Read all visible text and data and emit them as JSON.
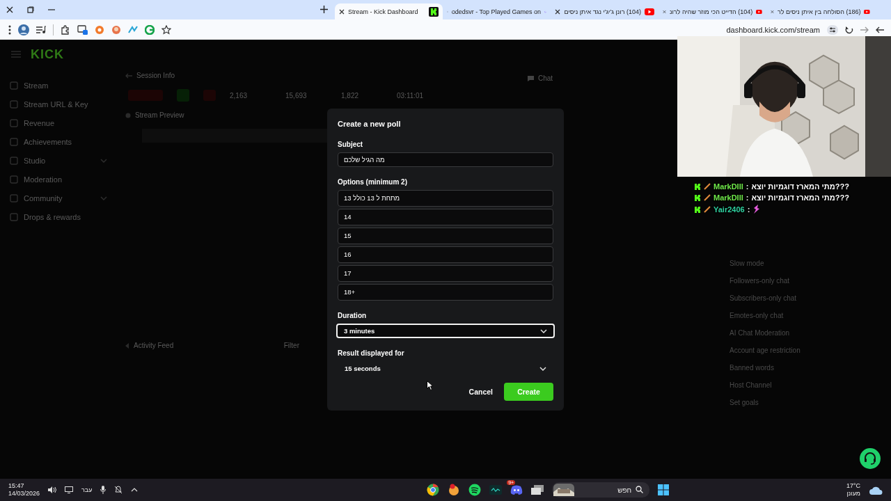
{
  "browser": {
    "tabs": [
      {
        "title": "(186) הסולחה בין איתן ניסים לר",
        "selected": false,
        "kind": "youtube"
      },
      {
        "title": "(104) הדייט הכי מוזר שהיה לרונ",
        "selected": false,
        "kind": "youtube"
      },
      {
        "title": "(104) רונן ג'יג'י נגד איתן ניסים",
        "selected": false,
        "kind": "youtube"
      },
      {
        "title": "odedsvr - Top Played Games on",
        "selected": false,
        "kind": "loading"
      },
      {
        "title": "Stream - Kick Dashboard",
        "selected": true,
        "kind": "kick"
      }
    ],
    "url": "dashboard.kick.com/stream"
  },
  "dashboard": {
    "logo": "KICK",
    "sidebar": [
      {
        "label": "Stream",
        "expandable": false
      },
      {
        "label": "Stream URL & Key",
        "expandable": false
      },
      {
        "label": "Revenue",
        "expandable": false
      },
      {
        "label": "Achievements",
        "expandable": false
      },
      {
        "label": "Studio",
        "expandable": true
      },
      {
        "label": "Moderation",
        "expandable": false
      },
      {
        "label": "Community",
        "expandable": true
      },
      {
        "label": "Drops & rewards",
        "expandable": false
      }
    ],
    "session_title": "Session Info",
    "stats": [
      "2,163",
      "15,693",
      "1,822",
      "03:11:01"
    ],
    "preview_title": "Stream Preview",
    "activity_title": "Activity Feed",
    "filter": "Filter",
    "chat_title": "Chat",
    "chat_settings": [
      "Slow mode",
      "Followers-only chat",
      "Subscribers-only chat",
      "Emotes-only chat",
      "AI Chat Moderation",
      "Account age restriction",
      "Banned words",
      "Host Channel",
      "Set goals"
    ]
  },
  "modal": {
    "title": "Create a new poll",
    "subject": {
      "label": "Subject",
      "value": "מה הגיל שלכם"
    },
    "options": {
      "label": "Options (minimum 2)",
      "values": [
        "מתחת ל 13 כולל 13",
        "14",
        "15",
        "16",
        "17",
        "18+"
      ]
    },
    "duration": {
      "label": "Duration",
      "value": "3 minutes",
      "focused": true
    },
    "result": {
      "label": "Result displayed for",
      "value": "15 seconds",
      "focused": false
    },
    "cancel": "Cancel",
    "create": "Create"
  },
  "chat_overlay": [
    {
      "username": "MarkDIII",
      "color": "#6fe84a",
      "separator": ":",
      "kind": "text",
      "text": "מתי המארז דוגמיות יוצא???"
    },
    {
      "username": "MarkDIII",
      "color": "#6fe84a",
      "separator": ":",
      "kind": "text",
      "text": "מתי המארז דוגמיות יוצא???"
    },
    {
      "username": "Yair2406",
      "color": "#2fd1a0",
      "separator": ":",
      "kind": "emote"
    }
  ],
  "taskbar": {
    "time": "15:47",
    "date": "14/03/2026",
    "language": "עבר",
    "discord_badge": "9+",
    "search_placeholder": "חפש",
    "temperature": "17°C",
    "weather": "מעונן"
  }
}
